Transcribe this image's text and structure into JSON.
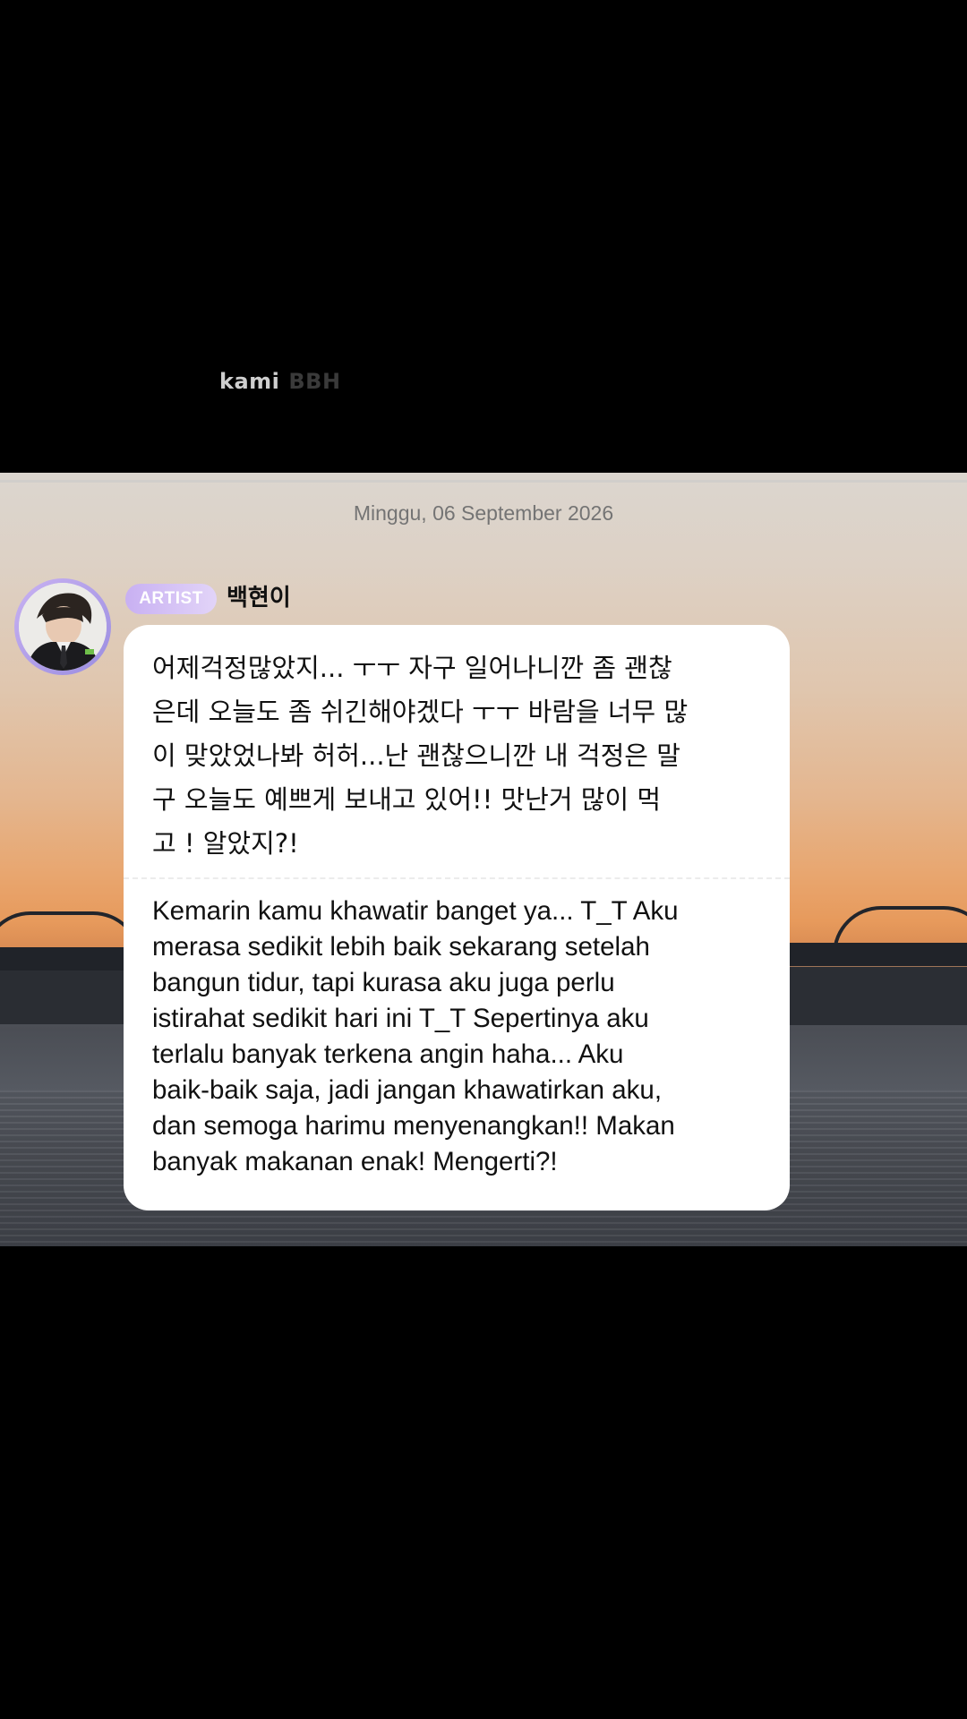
{
  "overlay": {
    "caption_word1": "kami",
    "caption_word2": "BBH"
  },
  "chat": {
    "date": "Minggu, 06 September 2026",
    "sender": {
      "badge": "ARTIST",
      "name": "백현이"
    },
    "message": {
      "original": "어제걱정많았지... ㅜㅜ 자구 일어나니깐 좀 괜찮\n은데 오늘도 좀 쉬긴해야겠다 ㅜㅜ 바람을 너무 많\n이 맞았었나봐 허허...난 괜찮으니깐 내 걱정은 말\n구 오늘도 예쁘게 보내고 있어!! 맛난거 많이 먹\n고 ! 알았지?!",
      "translation": "Kemarin kamu khawatir banget ya... T_T Aku\nmerasa sedikit lebih baik sekarang setelah\nbangun tidur, tapi kurasa aku juga perlu\nistirahat sedikit hari ini T_T Sepertinya aku\nterlalu banyak terkena angin haha... Aku\nbaik-baik saja, jadi jangan khawatirkan aku,\ndan semoga harimu menyenangkan!! Makan\nbanyak makanan enak! Mengerti?!"
    }
  }
}
